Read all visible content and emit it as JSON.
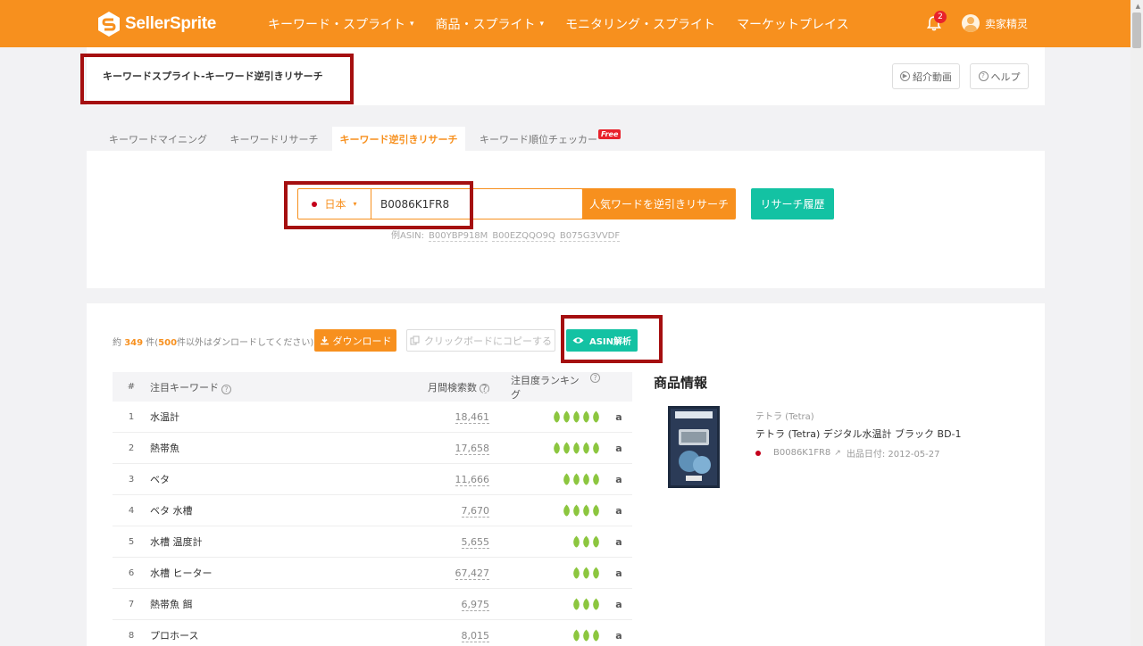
{
  "header": {
    "logo_text": "SellerSprite",
    "nav": [
      {
        "label": "キーワード・スプライト",
        "has_dropdown": true
      },
      {
        "label": "商品・スプライト",
        "has_dropdown": true
      },
      {
        "label": "モニタリング・スプライト",
        "has_dropdown": false
      },
      {
        "label": "マーケットプレイス",
        "has_dropdown": false
      }
    ],
    "notification_count": "2",
    "user_name": "卖家精灵"
  },
  "title_card": {
    "title": "キーワードスプライト-キーワード逆引きリサーチ",
    "video_button": "紹介動画",
    "help_button": "ヘルプ"
  },
  "tabs": [
    {
      "label": "キーワードマイニング"
    },
    {
      "label": "キーワードリサーチ"
    },
    {
      "label": "キーワード逆引きリサーチ"
    },
    {
      "label": "キーワード順位チェッカー"
    }
  ],
  "active_tab": "キーワード逆引きリサーチ",
  "free_badge": "Free",
  "search": {
    "market": "日本",
    "asin_value": "B0086K1FR8",
    "search_button": "人気ワードを逆引きリサーチ",
    "history_button": "リサーチ履歴",
    "examples_label": "例ASIN:",
    "examples": [
      "B00YBP918M",
      "B00EZQQO9Q",
      "B075G3VVDF"
    ]
  },
  "results": {
    "count_prefix": "約",
    "count": "349",
    "count_mid": "件(",
    "limit": "500",
    "count_suffix": "件以外はダンロードしてください)",
    "download_button": "ダウンロード",
    "copy_button": "クリックボードにコピーする",
    "asin_button": "ASIN解析",
    "columns": {
      "index": "#",
      "keyword": "注目キーワード",
      "volume": "月間検索数",
      "rank": "注目度ランキング"
    },
    "rows": [
      {
        "index": "1",
        "keyword": "水温計",
        "volume": "18,461",
        "leaves": 5
      },
      {
        "index": "2",
        "keyword": "熱帯魚",
        "volume": "17,658",
        "leaves": 5
      },
      {
        "index": "3",
        "keyword": "ベタ",
        "volume": "11,666",
        "leaves": 4
      },
      {
        "index": "4",
        "keyword": "ベタ 水槽",
        "volume": "7,670",
        "leaves": 4
      },
      {
        "index": "5",
        "keyword": "水槽 温度計",
        "volume": "5,655",
        "leaves": 3
      },
      {
        "index": "6",
        "keyword": "水槽 ヒーター",
        "volume": "67,427",
        "leaves": 3
      },
      {
        "index": "7",
        "keyword": "熱帯魚 餌",
        "volume": "6,975",
        "leaves": 3
      },
      {
        "index": "8",
        "keyword": "プロホース",
        "volume": "8,015",
        "leaves": 3
      }
    ],
    "amazon_glyph": "a"
  },
  "product": {
    "section_title": "商品情報",
    "brand": "テトラ (Tetra)",
    "name": "テトラ (Tetra) デジタル水温計 ブラック BD-1",
    "asin": "B0086K1FR8",
    "release": "出品日付: 2012-05-27"
  },
  "colors": {
    "brand_orange": "#f7901e",
    "teal": "#13c2a3",
    "highlight_red": "#a50f10",
    "leaf_green": "#8cc63f"
  }
}
